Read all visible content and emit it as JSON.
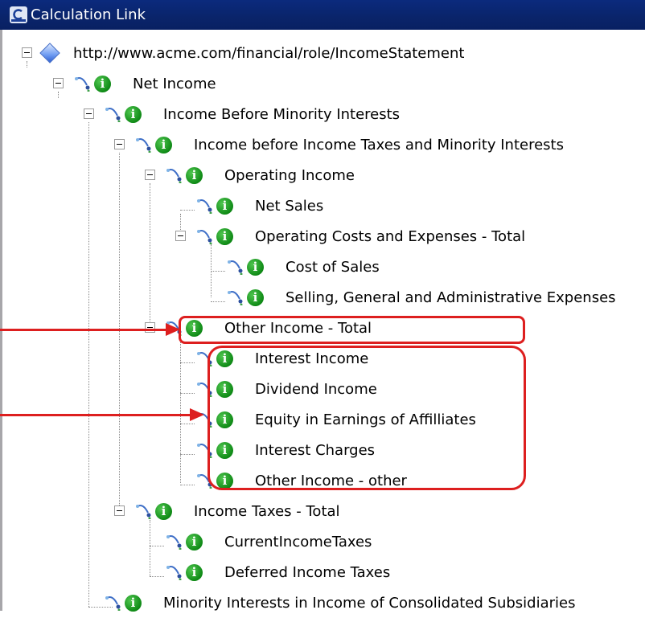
{
  "window": {
    "title": "Calculation Link"
  },
  "tree": {
    "root": "http://www.acme.com/financial/role/IncomeStatement",
    "items": [
      {
        "label": "Net Income"
      },
      {
        "label": "Income Before Minority Interests"
      },
      {
        "label": "Income before Income Taxes and Minority Interests"
      },
      {
        "label": "Operating Income"
      },
      {
        "label": "Net Sales"
      },
      {
        "label": "Operating Costs and Expenses - Total"
      },
      {
        "label": "Cost of Sales"
      },
      {
        "label": "Selling, General and Administrative Expenses"
      },
      {
        "label": "Other Income - Total"
      },
      {
        "label": "Interest Income"
      },
      {
        "label": "Dividend Income"
      },
      {
        "label": "Equity in Earnings of Affilliates"
      },
      {
        "label": "Interest Charges"
      },
      {
        "label": "Other Income - other"
      },
      {
        "label": "Income Taxes - Total"
      },
      {
        "label": "CurrentIncomeTaxes"
      },
      {
        "label": "Deferred Income Taxes"
      },
      {
        "label": "Minority Interests in Income of Consolidated Subsidiaries"
      }
    ]
  },
  "icons": {
    "concept_badge": "i"
  },
  "colors": {
    "titlebar": "#0a246a",
    "highlight": "#dd1f1f",
    "badge": "#119a1c"
  }
}
